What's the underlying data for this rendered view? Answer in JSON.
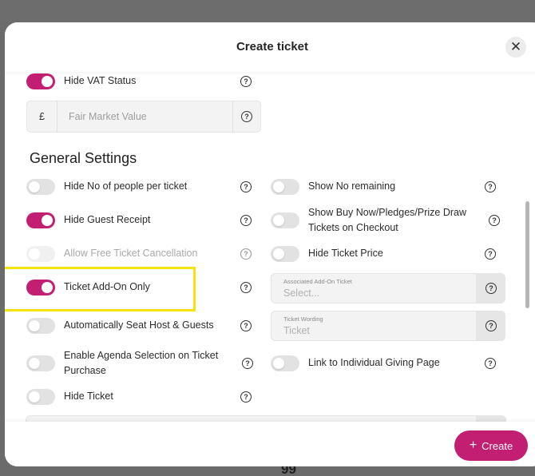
{
  "modal": {
    "title": "Create ticket",
    "close_icon": "close-icon"
  },
  "top_items": {
    "hide_vat_status": {
      "label": "Hide VAT Status",
      "state": "on"
    },
    "fair_market_value": {
      "currency_symbol": "£",
      "placeholder": "Fair Market Value"
    }
  },
  "general_settings": {
    "title": "General Settings",
    "left": [
      {
        "label": "Hide No of people per ticket",
        "state": "off"
      },
      {
        "label": "Hide Guest Receipt",
        "state": "on"
      },
      {
        "label": "Allow Free Ticket Cancellation",
        "state": "disabled"
      },
      {
        "label": "Ticket Add-On Only",
        "state": "on"
      },
      {
        "label": "Automatically Seat Host & Guests",
        "state": "off"
      },
      {
        "label": "Enable Agenda Selection on Ticket Purchase",
        "state": "off"
      },
      {
        "label": "Hide Ticket",
        "state": "off"
      }
    ],
    "right": [
      {
        "label": "Show No remaining",
        "state": "off"
      },
      {
        "label": "Show Buy Now/Pledges/Prize Draw Tickets on Checkout",
        "state": "off"
      },
      {
        "label": "Hide Ticket Price",
        "state": "off"
      },
      {
        "label": "Link to Individual Giving Page",
        "state": "off"
      }
    ],
    "associated_addon": {
      "label": "Associated Add-On Ticket",
      "placeholder": "Select..."
    },
    "ticket_wording": {
      "label": "Ticket Wording",
      "value": "Ticket"
    }
  },
  "help_glyph": "?",
  "footer": {
    "create_label": "Create",
    "plus": "+"
  },
  "background_text": "99",
  "colors": {
    "accent": "#c21f72",
    "highlight": "#f4e30c"
  }
}
